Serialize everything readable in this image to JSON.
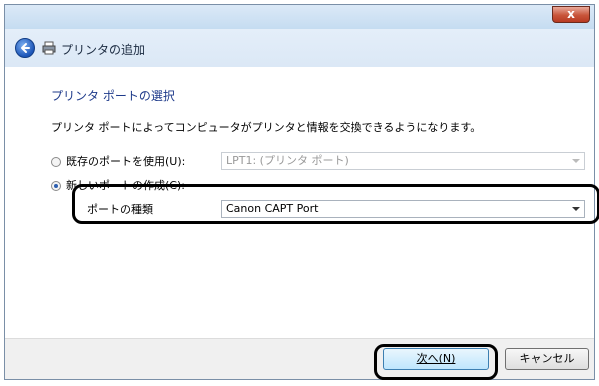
{
  "window": {
    "title": "プリンタの追加",
    "close_label": "x"
  },
  "page": {
    "section_title": "プリンタ ポートの選択",
    "description": "プリンタ ポートによってコンピュータがプリンタと情報を交換できるようになります。"
  },
  "options": {
    "existing_port_label": "既存のポートを使用(U):",
    "existing_port_value": "LPT1: (プリンタ ポート)",
    "new_port_label": "新しいポートの作成(C):",
    "port_type_label": "ポートの種類",
    "port_type_value": "Canon CAPT Port"
  },
  "buttons": {
    "next_label": "次へ(N)",
    "cancel_label": "キャンセル"
  },
  "icons": {
    "back": "back-arrow-icon",
    "printer": "printer-icon",
    "close": "close-icon"
  },
  "colors": {
    "accent": "#1e3a8a",
    "close": "#c8553a"
  }
}
